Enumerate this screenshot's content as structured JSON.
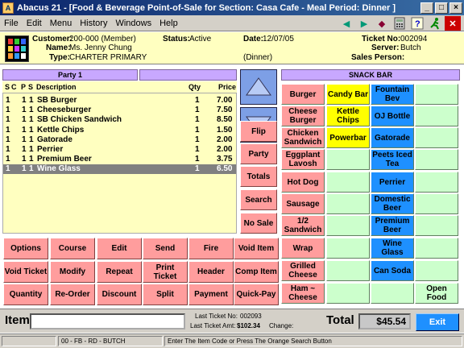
{
  "window": {
    "title": "Abacus 21 - [Food & Beverage Point-of-Sale for Section: Casa Cafe - Meal Period: Dinner ]",
    "app_icon_letter": "A"
  },
  "menu": [
    "File",
    "Edit",
    "Menu",
    "History",
    "Windows",
    "Help"
  ],
  "toolbar_icons": [
    "arrow-left-icon",
    "arrow-right-icon",
    "gem-icon",
    "calculator-icon",
    "help-icon",
    "runner-icon",
    "close-icon"
  ],
  "info": {
    "customer_label": "Customer:",
    "customer": "200-000 (Member)",
    "name_label": "Name:",
    "name": "Ms. Jenny Chung",
    "type_label": "Type:",
    "type": "CHARTER PRIMARY",
    "status_label": "Status:",
    "status": "Active",
    "date_label": "Date:",
    "date": "12/07/05",
    "period": "(Dinner)",
    "ticket_label": "Ticket No:",
    "ticket": "002094",
    "server_label": "Server:",
    "server": "Butch",
    "salesperson_label": "Sales Person:",
    "salesperson": ""
  },
  "party_header": "Party 1",
  "snack_header": "SNACK BAR",
  "columns": {
    "s": "S",
    "c": "C",
    "p": "P",
    "s2": "S",
    "desc": "Description",
    "qty": "Qty",
    "price": "Price"
  },
  "order_items": [
    {
      "s": "1",
      "c": "",
      "p": "1",
      "s2": "1",
      "desc": "SB Burger",
      "qty": "1",
      "price": "7.00"
    },
    {
      "s": "1",
      "c": "",
      "p": "1",
      "s2": "1",
      "desc": "Cheeseburger",
      "qty": "1",
      "price": "7.50"
    },
    {
      "s": "1",
      "c": "",
      "p": "1",
      "s2": "1",
      "desc": "SB Chicken Sandwich",
      "qty": "1",
      "price": "8.50"
    },
    {
      "s": "1",
      "c": "",
      "p": "1",
      "s2": "1",
      "desc": "Kettle Chips",
      "qty": "1",
      "price": "1.50"
    },
    {
      "s": "1",
      "c": "",
      "p": "1",
      "s2": "1",
      "desc": "Gatorade",
      "qty": "1",
      "price": "2.00"
    },
    {
      "s": "1",
      "c": "",
      "p": "1",
      "s2": "1",
      "desc": "Perrier",
      "qty": "1",
      "price": "2.00"
    },
    {
      "s": "1",
      "c": "",
      "p": "1",
      "s2": "1",
      "desc": "Premium Beer",
      "qty": "1",
      "price": "3.75"
    },
    {
      "s": "1",
      "c": "",
      "p": "1",
      "s2": "1",
      "desc": "Wine Glass",
      "qty": "1",
      "price": "6.50",
      "selected": true
    }
  ],
  "side_buttons": [
    "Flip",
    "Party",
    "Totals",
    "Search",
    "No Sale"
  ],
  "func_buttons": [
    [
      "Options",
      "Course",
      "Edit",
      "Send",
      "Fire",
      "Void Item"
    ],
    [
      "Void Ticket",
      "Modify",
      "Repeat",
      "Print Ticket",
      "Header",
      "Comp Item"
    ],
    [
      "Quantity",
      "Re-Order",
      "Discount",
      "Split",
      "Payment",
      "Quick-Pay"
    ]
  ],
  "grid": {
    "col1": [
      "Burger",
      "Cheese Burger",
      "Chicken Sandwich",
      "Eggplant Lavosh",
      "Hot Dog",
      "Sausage",
      "1/2 Sandwich",
      "Wrap",
      "Grilled Cheese",
      "Ham ~ Cheese"
    ],
    "col2": [
      "Candy Bar",
      "Kettle Chips",
      "Powerbar",
      "",
      "",
      "",
      "",
      "",
      "",
      ""
    ],
    "col3": [
      "Fountain Bev",
      "OJ Bottle",
      "Gatorade",
      "Peets Iced Tea",
      "Perrier",
      "Domestic Beer",
      "Premium Beer",
      "Wine Glass",
      "Can Soda",
      ""
    ],
    "col4": [
      "",
      "",
      "",
      "",
      "",
      "",
      "",
      "",
      "",
      "Open Food"
    ]
  },
  "colors": {
    "pink": "#ff9d9d",
    "yellow": "#ffff00",
    "blue": "#1e90ff",
    "green": "#ccffcc",
    "lavender": "#c8a8ff",
    "cream": "#ffffc0",
    "title": "#0a246a"
  },
  "bottom": {
    "item_label": "Item",
    "item_value": "",
    "last_ticket_label": "Last Ticket No:",
    "last_ticket": "002093",
    "last_amt_label": "Last Ticket Amt:",
    "last_amt": "$102.34",
    "change_label": "Change:",
    "change": "",
    "total_label": "Total",
    "total": "$45.54",
    "exit": "Exit"
  },
  "status": {
    "left": "",
    "mid": "00 - FB - RD - BUTCH",
    "msg": "Enter The Item Code or Press The Orange Search Button"
  }
}
